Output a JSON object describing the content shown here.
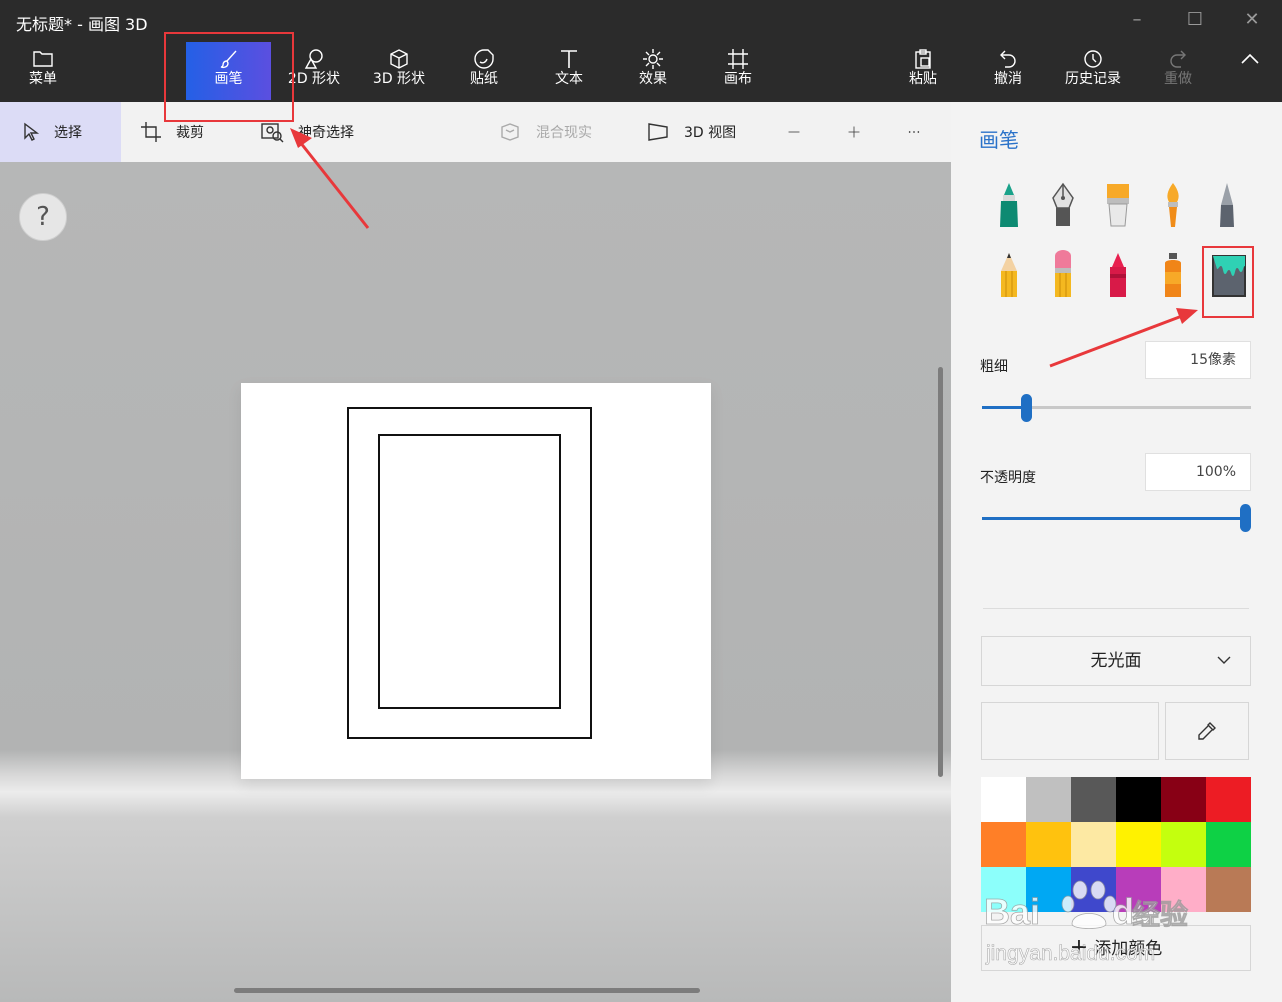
{
  "window": {
    "title": "无标题* - 画图 3D"
  },
  "toolbar": [
    {
      "label": "菜单",
      "icon": "folder-icon",
      "name": "menu-button"
    },
    {
      "label": "画笔",
      "icon": "brush-icon",
      "name": "brushes-tab",
      "active": true
    },
    {
      "label": "2D 形状",
      "icon": "shapes-2d-icon",
      "name": "shapes2d-tab"
    },
    {
      "label": "3D 形状",
      "icon": "cube-icon",
      "name": "shapes3d-tab"
    },
    {
      "label": "贴纸",
      "icon": "sticker-icon",
      "name": "stickers-tab"
    },
    {
      "label": "文本",
      "icon": "text-icon",
      "name": "text-tab"
    },
    {
      "label": "效果",
      "icon": "sun-icon",
      "name": "effects-tab"
    },
    {
      "label": "画布",
      "icon": "canvas-icon",
      "name": "canvas-tab"
    },
    {
      "label": "粘贴",
      "icon": "paste-icon",
      "name": "paste-button"
    },
    {
      "label": "撤消",
      "icon": "undo-icon",
      "name": "undo-button"
    },
    {
      "label": "历史记录",
      "icon": "history-icon",
      "name": "history-button"
    },
    {
      "label": "重做",
      "icon": "redo-icon",
      "name": "redo-button",
      "disabled": true
    }
  ],
  "subbar": {
    "select": "选择",
    "crop": "裁剪",
    "magic_select": "神奇选择",
    "mixed_reality": "混合现实",
    "view3d": "3D 视图"
  },
  "canvas": {
    "help": "?"
  },
  "panel": {
    "title": "画笔",
    "brushes": [
      "marker-icon",
      "calligraphy-pen-icon",
      "oil-brush-icon",
      "watercolor-icon",
      "pixel-pen-icon",
      "pencil-icon",
      "eraser-icon",
      "crayon-icon",
      "spray-can-icon",
      "fill-bucket-icon"
    ],
    "thickness_label": "粗细",
    "thickness_value": "15像素",
    "thickness_level": 0.15,
    "opacity_label": "不透明度",
    "opacity_value": "100%",
    "opacity_level": 1.0,
    "finish": "无光面",
    "add_color": "添加颜色",
    "swatches": [
      "#ffffff",
      "#c0c0c0",
      "#585858",
      "#000000",
      "#880015",
      "#ed1c24",
      "#ff7f27",
      "#ffc20e",
      "#fde9a3",
      "#fff200",
      "#c4ff0e",
      "#0ed145",
      "#8cfffb",
      "#00a8f3",
      "#3f48cc",
      "#b83dba",
      "#ffaec8",
      "#b97a56"
    ]
  },
  "watermark": {
    "text1": "Bai",
    "text2": "du",
    "text3": "经验",
    "url": "jingyan.baidu.com"
  }
}
